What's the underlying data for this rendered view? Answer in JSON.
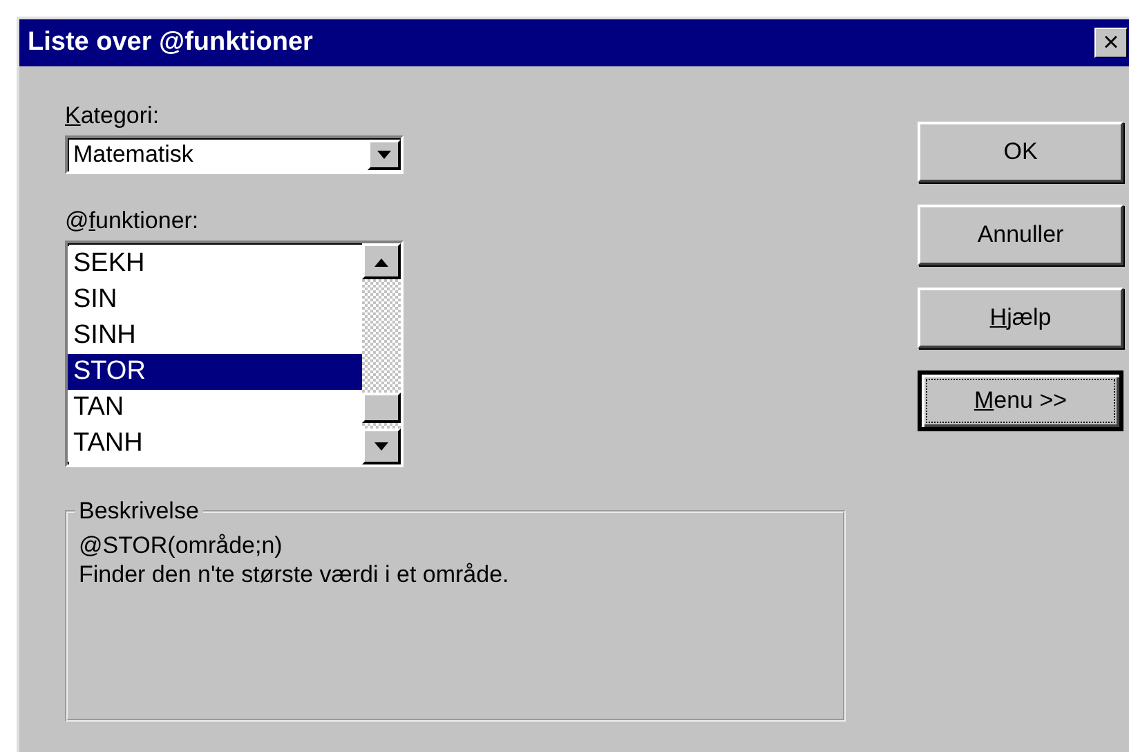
{
  "window": {
    "title": "Liste over @funktioner",
    "close": "×"
  },
  "category": {
    "label": {
      "mnemonic": "K",
      "after": "ategori:"
    },
    "value": "Matematisk"
  },
  "functions": {
    "label": {
      "before": "@",
      "mnemonic": "f",
      "after": "unktioner:"
    },
    "items": [
      {
        "name": "SEKH",
        "selected": false
      },
      {
        "name": "SIN",
        "selected": false
      },
      {
        "name": "SINH",
        "selected": false
      },
      {
        "name": "STOR",
        "selected": true
      },
      {
        "name": "TAN",
        "selected": false
      },
      {
        "name": "TANH",
        "selected": false
      }
    ]
  },
  "description": {
    "title": "Beskrivelse",
    "syntax": "@STOR(område;n)",
    "text": "Finder den n'te største værdi i et område."
  },
  "buttons": [
    {
      "label": {
        "after": "OK"
      },
      "focused": false
    },
    {
      "label": {
        "after": "Annuller"
      },
      "focused": false
    },
    {
      "label": {
        "mnemonic": "H",
        "after": "jælp"
      },
      "focused": false
    },
    {
      "label": {
        "mnemonic": "M",
        "after": "enu >>"
      },
      "focused": true
    }
  ]
}
